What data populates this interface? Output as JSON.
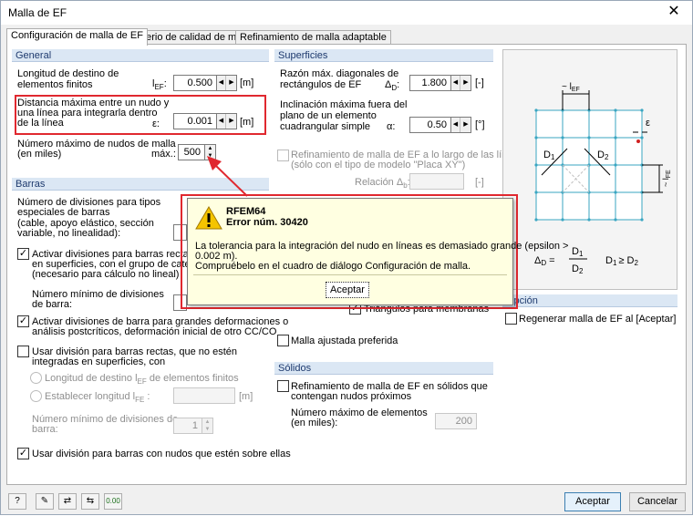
{
  "window": {
    "title": "Malla de EF",
    "close": "✕"
  },
  "tabs": [
    {
      "label": "Configuración de malla de EF"
    },
    {
      "label": "Criterio de calidad de malla"
    },
    {
      "label": "Refinamiento de malla adaptable"
    }
  ],
  "general": {
    "title": "General",
    "target_label_1": "Longitud de destino de",
    "target_label_2": "elementos finitos",
    "target_sym": "l",
    "target_sym_sub": "EF",
    "target_value": "0.500",
    "target_unit": "[m]",
    "dist_label_1": "Distancia máxima entre un nudo y",
    "dist_label_2": "una línea para integrarla dentro",
    "dist_label_3": "de la línea",
    "dist_sym": "ε:",
    "dist_value": "0.001",
    "dist_unit": "[m]",
    "nodes_label_1": "Número máximo de nudos de malla",
    "nodes_label_2": "(en miles)",
    "nodes_sym": "máx.:",
    "nodes_value": "500"
  },
  "barras": {
    "title": "Barras",
    "div_label_1": "Número de divisiones para tipos",
    "div_label_2": "especiales de barras",
    "div_label_3": "(cable, apoyo elástico, sección",
    "div_label_4": "variable, no linealidad):",
    "activate_1_l1": "Activar divisiones para barras rectas, que no estén",
    "activate_1_l2": "en superficies, con el grupo de categoría de carga",
    "activate_1_l3": "(necesario para cálculo no lineal)",
    "min_div_1": "Número mínimo de divisiones",
    "min_div_2": "de barra:",
    "activate_2_l1": "Activar divisiones de barra para grandes deformaciones o",
    "activate_2_l2": "análisis postcríticos, deformación inicial de otro CC/CO",
    "use_div_l1": "Usar división para barras rectas, que no estén",
    "use_div_l2": "integradas en superficies, con",
    "radio_1": "Longitud de destino l",
    "radio_1_sub": "EF",
    "radio_1_tail": " de elementos finitos",
    "radio_2": "Establecer longitud l",
    "radio_2_sub": "FE",
    "radio_2_tail": " :",
    "radio_unit": "[m]",
    "min_div_b1": "Número mínimo de divisiones de",
    "min_div_b2": "barra:",
    "min_div_value": "1",
    "use_nodes": "Usar división para barras con nudos que estén sobre ellas"
  },
  "superficies": {
    "title": "Superficies",
    "ratio_l1": "Razón máx. diagonales de",
    "ratio_l2": "rectángulos de EF",
    "ratio_sym": "Δ",
    "ratio_sym_sub": "D",
    "ratio_value": "1.800",
    "ratio_unit": "[-]",
    "incl_l1": "Inclinación máxima fuera del",
    "incl_l2": "plano de un elemento",
    "incl_l3": "cuadrangular simple",
    "incl_sym": "α:",
    "incl_value": "0.50",
    "incl_unit": "[°]",
    "refine_l1": "Refinamiento de malla de EF a lo largo de las líneas",
    "refine_l2": "(sólo con el tipo de modelo \"Placa XY\")",
    "rel_label": "Relación Δ",
    "rel_sub": "b",
    "rel_unit": "[-]",
    "triangles": "Triángulos para membranas",
    "adjusted": "Malla ajustada preferida"
  },
  "solidos": {
    "title": "Sólidos",
    "refine_l1": "Refinamiento de malla de EF en sólidos que",
    "refine_l2": "contengan nudos próximos",
    "max_l1": "Número  máximo de elementos",
    "max_l2": "(en miles):",
    "max_value": "200"
  },
  "opcion": {
    "title": "Opción",
    "regen": "Regenerar malla de EF al [Aceptar]"
  },
  "diagram": {
    "lfe_top": "~ l",
    "lfe_top_sub": "EF",
    "eps": "ε",
    "lfe_side": "~ l",
    "lfe_side_sub": "FE",
    "d1": "D",
    "d1_sub": "1",
    "d2": "D",
    "d2_sub": "2",
    "formula_lhs": "Δ",
    "formula_lhs_sub": "D",
    "formula_eq": "=",
    "frac_num": "D",
    "frac_num_sub": "1",
    "frac_den": "D",
    "frac_den_sub": "2",
    "cond": "D",
    "cond_sub": "1",
    "cond_geq": "≥ D",
    "cond_sub2": "2"
  },
  "popup": {
    "app": "RFEM64",
    "error": "Error núm.  30420",
    "msg_1": "La tolerancia para la integración del nudo en líneas es demasiado grande (epsilon >",
    "msg_2": "0.002 m).",
    "msg_3": "Compruébelo en el cuadro de diálogo Configuración de malla.",
    "ok": "Aceptar"
  },
  "footer": {
    "ok": "Aceptar",
    "cancel": "Cancelar",
    "tools": [
      "?",
      "✎",
      "⇄",
      "⇆",
      "0.00"
    ]
  },
  "colors": {
    "accent_red": "#e0282f",
    "group_header": "#dbe7f4",
    "popup_bg": "#ffffe1",
    "grid_line": "#3aa6c2"
  }
}
